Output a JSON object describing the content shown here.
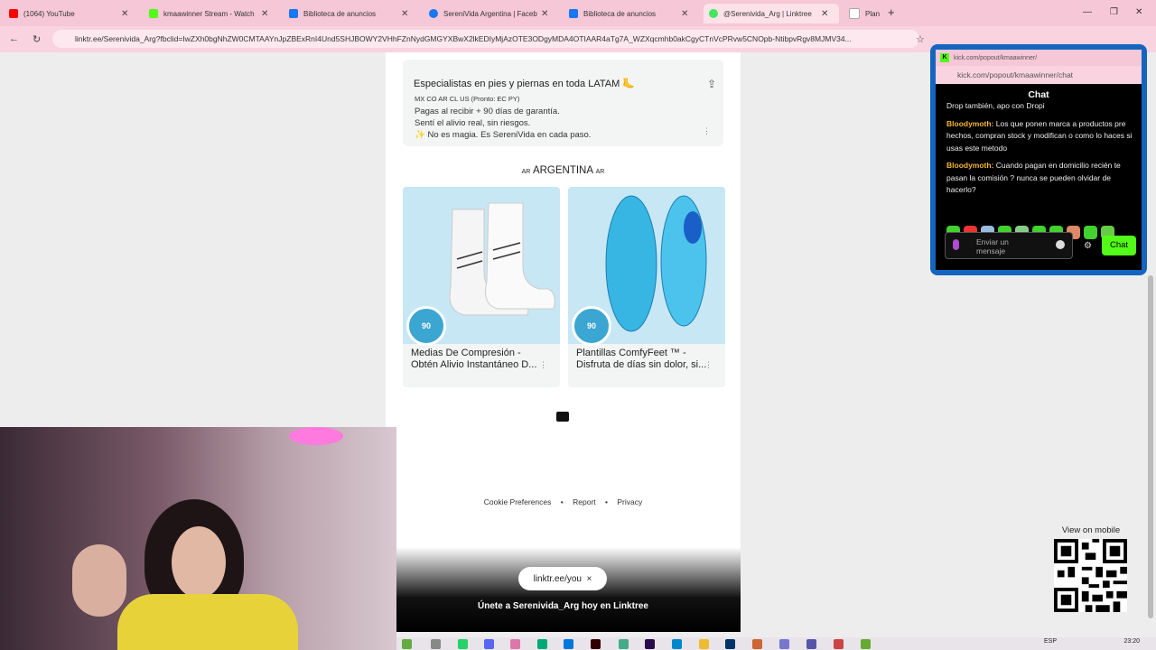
{
  "browser": {
    "tabs": [
      {
        "title": "(1064) YouTube",
        "color": "#ff0000"
      },
      {
        "title": "kmaawinner Stream - Watch",
        "color": "#53fc18"
      },
      {
        "title": "Biblioteca de anuncios",
        "color": "#1877f2"
      },
      {
        "title": "SereniVida Argentina | Faceb",
        "color": "#1877f2"
      },
      {
        "title": "Biblioteca de anuncios",
        "color": "#1877f2"
      },
      {
        "title": "@Serenivida_Arg | Linktree",
        "color": "#43e660"
      },
      {
        "title": "Plant",
        "color": "#ffffff"
      }
    ],
    "url": "linktr.ee/Serenivida_Arg?fbclid=IwZXh0bgNhZW0CMTAAYnJpZBExRnI4Und5SHJBOWY2VHhFZnNydGMGYXBwX2lkEDIyMjAzOTE3ODgyMDA4OTIAAR4aTg7A_WZXqcmhb0akCgyCTnVcPRvw5CNOpb-NtibpvRgv8MJMV34..."
  },
  "profile_card": {
    "headline": "Especialistas en pies y piernas en toda LATAM 🦶",
    "countries": "MX CO AR CL US (Pronto: EC PY)",
    "line1": "Pagas al recibir + 90 días de garantía.",
    "line2": "Sentí el alivio real, sin riesgos.",
    "line3": "✨ No es magia. Es SereniVida en cada paso."
  },
  "section": {
    "flag": "AR",
    "title": "ARGENTINA"
  },
  "products": [
    {
      "title": "Medias De Compresión - Obtén Alivio Instantáneo D...",
      "badge": "90"
    },
    {
      "title": "Plantillas ComfyFeet ™ - Disfruta de días sin dolor, si...",
      "badge": "90"
    }
  ],
  "footer": {
    "cookie": "Cookie Preferences",
    "report": "Report",
    "privacy": "Privacy",
    "sep": "•"
  },
  "join_bar": {
    "pill": "linktr.ee/you",
    "close": "×",
    "text": "Únete a Serenivida_Arg hoy en Linktree"
  },
  "chat": {
    "window_title": "kick.com/popout/kmaawinner/",
    "url": "kick.com/popout/kmaawinner/chat",
    "header": "Chat",
    "messages": [
      {
        "user": "",
        "text": "Drop también, apo con Dropi"
      },
      {
        "user": "Bloodymoth:",
        "text": "Los que ponen marca a productos pre hechos, compran stock y modifican o como lo haces si usas este metodo"
      },
      {
        "user": "Bloodymoth:",
        "text": "Cuando pagan en domicilio recién te pasan la comisión ? nunca se pueden olvidar de hacerlo?"
      }
    ],
    "input_placeholder": "Enviar un mensaje",
    "send": "Chat"
  },
  "qr": {
    "label": "View on mobile"
  },
  "taskbar": {
    "lang": "ESP",
    "time": "23:20"
  }
}
